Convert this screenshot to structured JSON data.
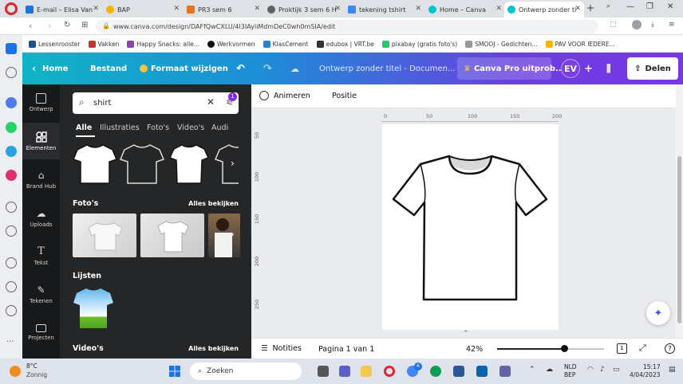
{
  "browser": {
    "tabs": [
      {
        "label": "E-mail – Elisa Van",
        "color": "#1e72d8"
      },
      {
        "label": "BAP",
        "color": "#f4b400"
      },
      {
        "label": "PR3 sem 6",
        "color": "#e8711c"
      },
      {
        "label": "Proktijk 3 sem 6 H",
        "color": "#5f6368"
      },
      {
        "label": "tekening tshirt",
        "color": "#4285f4"
      },
      {
        "label": "Home – Canva",
        "color": "#00c4cc"
      },
      {
        "label": "Ontwerp zonder ti",
        "color": "#00c4cc"
      }
    ],
    "url": "www.canva.com/design/DAFfQwCXLU/4l3IAyiiMdmDeC0wh0mSIA/edit",
    "bookmarks": [
      {
        "label": "Lessenrooster",
        "color": "#1f4e8c"
      },
      {
        "label": "Vakken",
        "color": "#c0392b"
      },
      {
        "label": "Happy Snacks: alle...",
        "color": "#8e44ad"
      },
      {
        "label": "Werkvormen",
        "color": "#111111"
      },
      {
        "label": "KlasCement",
        "color": "#2c82c9"
      },
      {
        "label": "edubox | VRT.be",
        "color": "#333333"
      },
      {
        "label": "pixabay (gratis foto's)",
        "color": "#2ec66d"
      },
      {
        "label": "SMOOJ - Gedichten...",
        "color": "#999999"
      },
      {
        "label": "PAV VOOR IEDERE...",
        "color": "#f4b400"
      }
    ]
  },
  "canva": {
    "header": {
      "home": "Home",
      "file": "Bestand",
      "resize": "Formaat wijzigen",
      "title": "Ontwerp zonder titel - Documen...",
      "pro": "Canva Pro uitprob...",
      "avatar": "EV",
      "share": "Delen"
    },
    "rail": [
      {
        "label": "Ontwerp",
        "icon": "layout-icon"
      },
      {
        "label": "Elementen",
        "icon": "shapes-icon"
      },
      {
        "label": "Brand Hub",
        "icon": "brand-icon"
      },
      {
        "label": "Uploads",
        "icon": "upload-icon"
      },
      {
        "label": "Tekst",
        "icon": "text-icon"
      },
      {
        "label": "Tekenen",
        "icon": "draw-icon"
      },
      {
        "label": "Projecten",
        "icon": "folder-icon"
      }
    ],
    "panel": {
      "search_value": "shirt",
      "filter_badge": "1",
      "tabs": [
        "Alle",
        "Illustraties",
        "Foto's",
        "Video's",
        "Audio"
      ],
      "sections": {
        "photos": "Foto's",
        "lists": "Lijsten",
        "videos": "Video's",
        "see_all": "Alles bekijken"
      }
    },
    "toolbar": {
      "animate": "Animeren",
      "position": "Positie"
    },
    "rulers": {
      "top": [
        "0",
        "50",
        "100",
        "150",
        "200"
      ],
      "left": [
        "50",
        "100",
        "150",
        "200",
        "250"
      ]
    },
    "bottom": {
      "notes": "Notities",
      "page": "Pagina 1 van 1",
      "zoom": "42%",
      "zoom_fraction": 0.42,
      "page_count": "1"
    }
  },
  "taskbar": {
    "weather_temp": "8°C",
    "weather_desc": "Zonnig",
    "search": "Zoeken",
    "lang1": "NLD",
    "lang2": "BEP",
    "time": "15:17",
    "date": "4/04/2023",
    "notification_badge": "6"
  }
}
